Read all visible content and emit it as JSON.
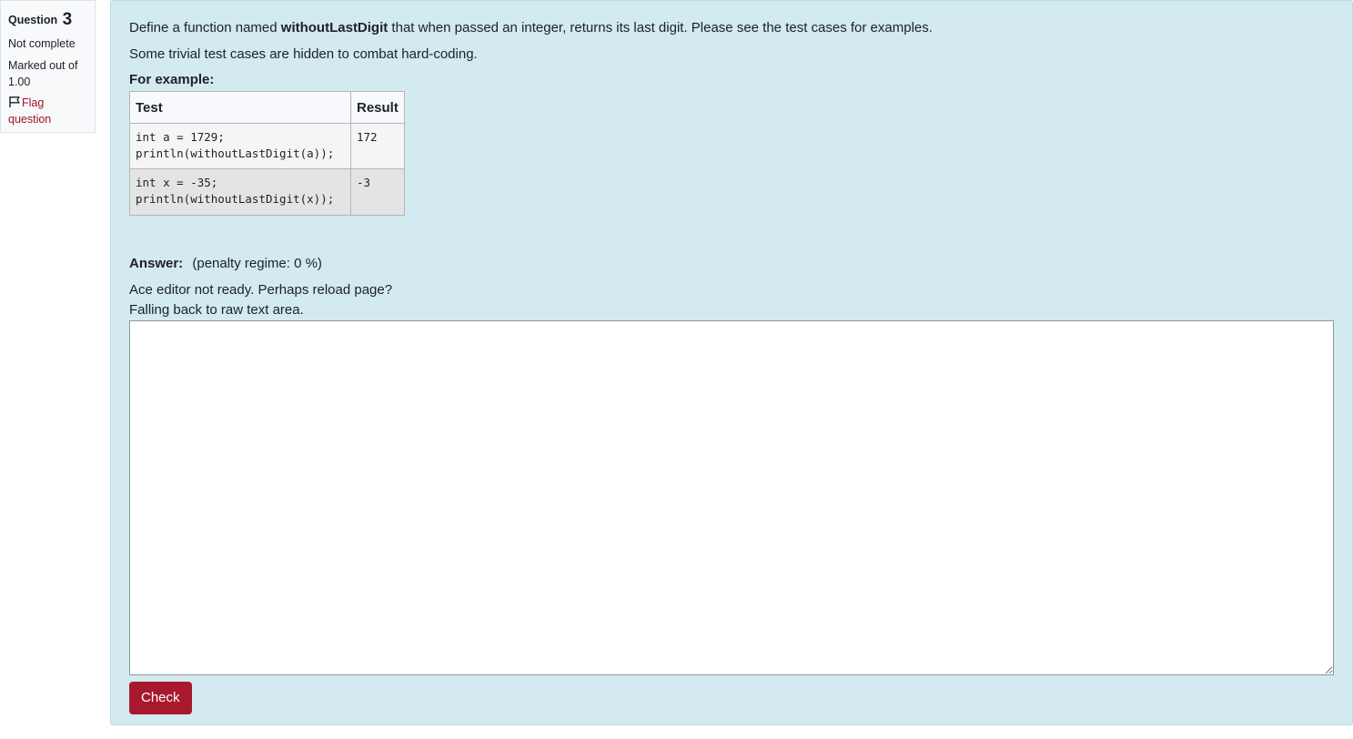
{
  "info": {
    "question_label": "Question",
    "question_number": "3",
    "state": "Not complete",
    "grade_line1": "Marked out of",
    "grade_line2": "1.00",
    "flag_line1": "Flag",
    "flag_line2": "question"
  },
  "question": {
    "text_before": "Define a function named ",
    "function_name": "withoutLastDigit",
    "text_after": " that when passed an integer, returns its last digit. Please see the test cases for examples.",
    "hidden_note": "Some trivial test cases are hidden to combat hard-coding.",
    "for_example": "For example:"
  },
  "examples": {
    "headers": [
      "Test",
      "Result"
    ],
    "rows": [
      {
        "test": "int a = 1729;\nprintln(withoutLastDigit(a));",
        "result": "172"
      },
      {
        "test": "int x = -35;\nprintln(withoutLastDigit(x));",
        "result": "-3"
      }
    ]
  },
  "answer": {
    "label": "Answer:",
    "penalty": "(penalty regime: 0 %)",
    "ace_msg_line1": "Ace editor not ready. Perhaps reload page?",
    "ace_msg_line2": "Falling back to raw text area.",
    "value": ""
  },
  "actions": {
    "check_label": "Check"
  },
  "colors": {
    "content_bg": "#d2eaf0",
    "accent": "#a8192e",
    "flag_text": "#a0152a"
  }
}
